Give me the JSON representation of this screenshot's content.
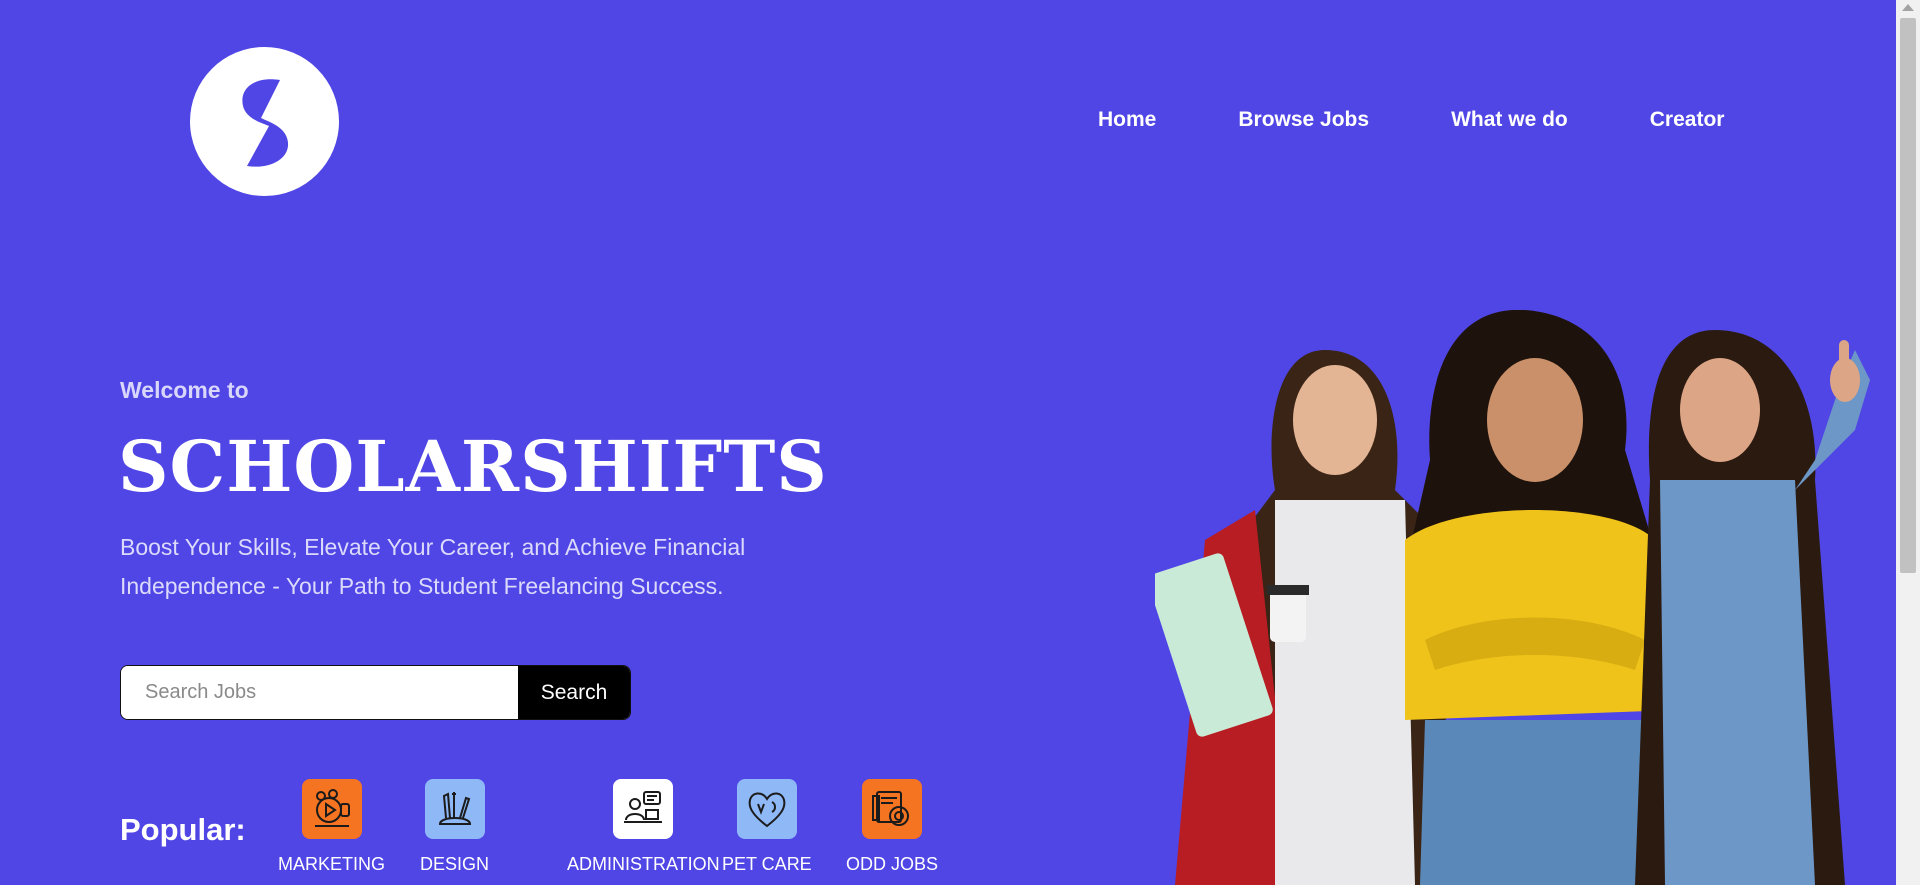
{
  "header": {
    "logo_letter": "S",
    "nav": [
      "Home",
      "Browse Jobs",
      "What we do",
      "Creator"
    ]
  },
  "hero": {
    "welcome": "Welcome to",
    "brand": "SCHOLARSHIFTS",
    "tagline_line1": "Boost Your Skills, Elevate Your Career, and Achieve Financial",
    "tagline_line2": "Independence - Your Path to Student Freelancing Success."
  },
  "search": {
    "placeholder": "Search Jobs",
    "button_label": "Search"
  },
  "popular": {
    "label": "Popular:",
    "categories": [
      {
        "label": "MARKETING",
        "icon": "marketing-video-icon",
        "color": "#f47421"
      },
      {
        "label": "DESIGN",
        "icon": "design-tools-icon",
        "color": "#8fb8f7"
      },
      {
        "label": "ADMINISTRATION",
        "icon": "administration-desk-icon",
        "color": "#ffffff"
      },
      {
        "label": "PET CARE",
        "icon": "pet-heart-icon",
        "color": "#8fb8f7"
      },
      {
        "label": "ODD JOBS",
        "icon": "odd-jobs-icon",
        "color": "#f47421"
      }
    ]
  },
  "colors": {
    "background": "#5046e5",
    "accent_orange": "#f47421",
    "accent_blue": "#8fb8f7"
  }
}
